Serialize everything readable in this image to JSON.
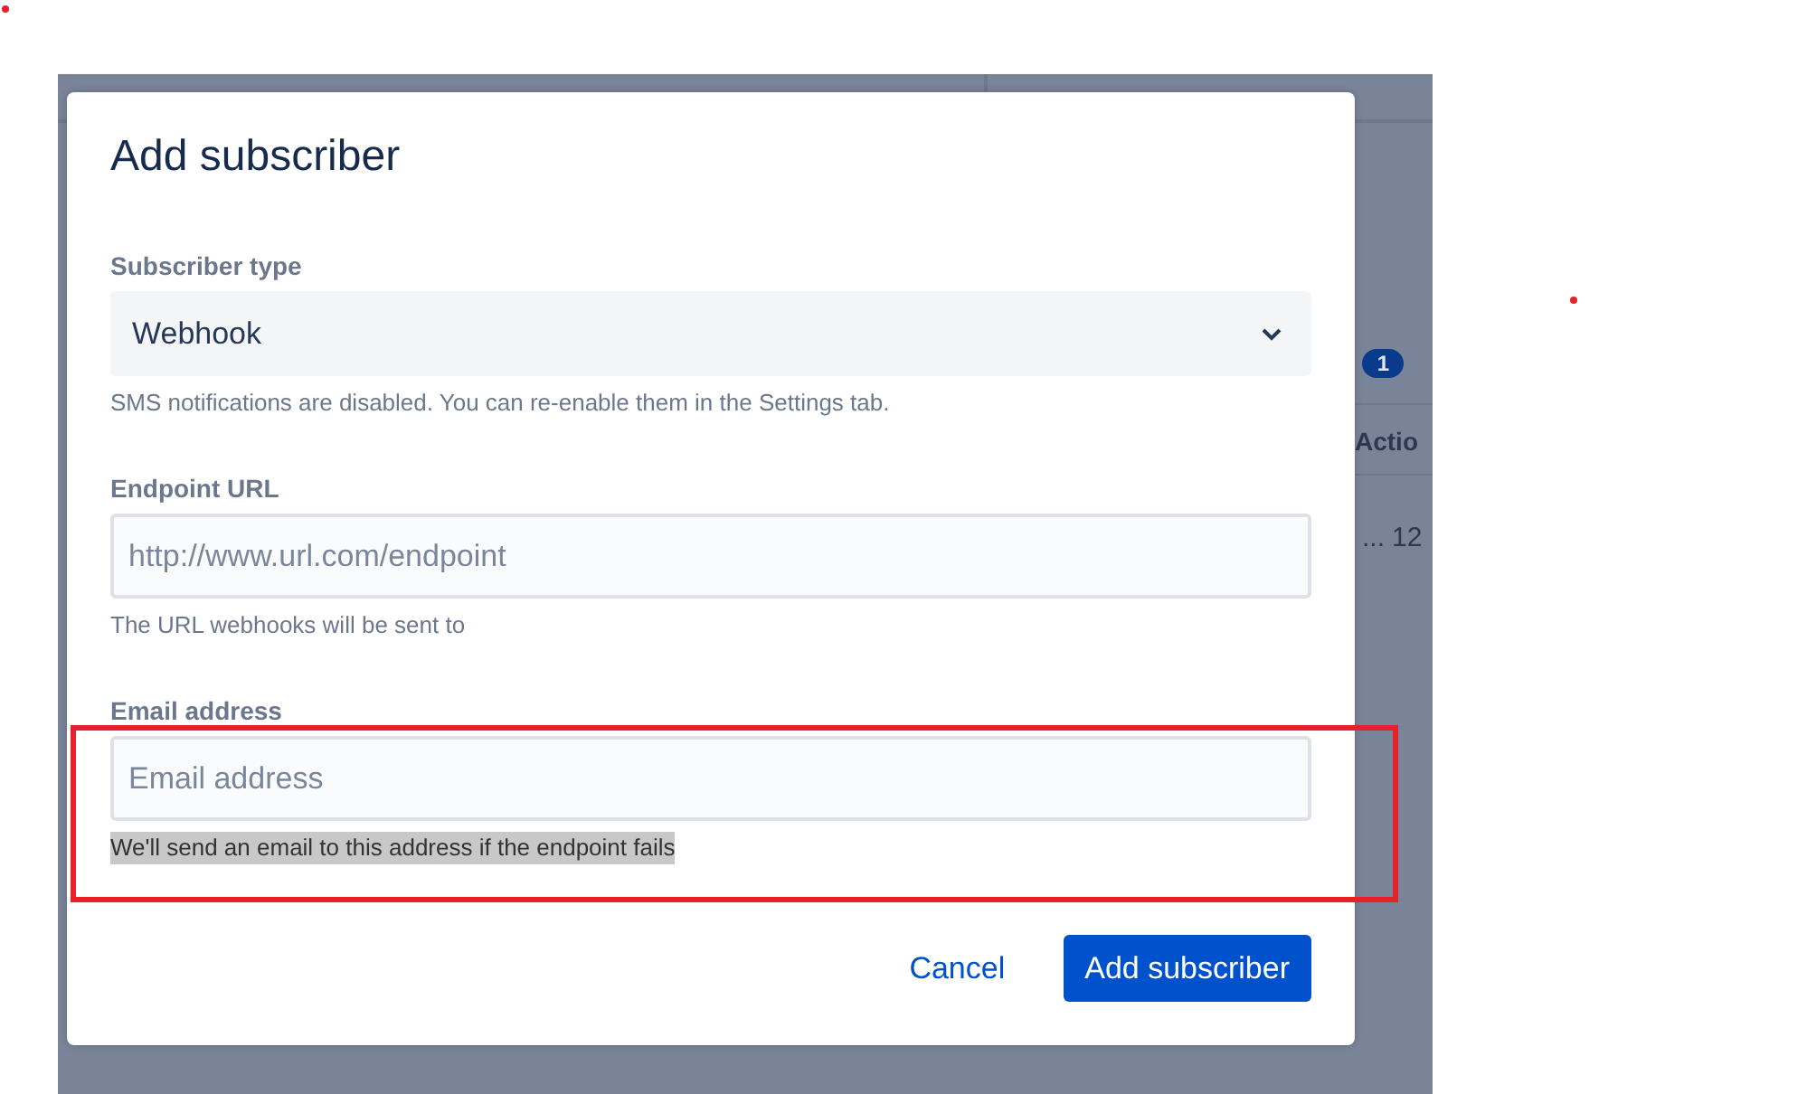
{
  "background_page": {
    "badge": "1",
    "column_header": "Actio",
    "row_cell_1": "...",
    "row_cell_2": "12"
  },
  "modal": {
    "title": "Add subscriber",
    "fields": [
      {
        "kind": "select",
        "label": "Subscriber type",
        "value": "Webhook",
        "helper": "SMS notifications are disabled. You can re-enable them in the Settings tab.",
        "helper_highlighted": false
      },
      {
        "kind": "input",
        "label": "Endpoint URL",
        "placeholder": "http://www.url.com/endpoint",
        "helper": "The URL webhooks will be sent to",
        "helper_highlighted": false
      },
      {
        "kind": "input",
        "label": "Email address",
        "placeholder": "Email address",
        "helper": "We'll send an email to this address if the endpoint fails",
        "helper_highlighted": true
      }
    ],
    "buttons": [
      {
        "kind": "link",
        "label": "Cancel"
      },
      {
        "kind": "primary",
        "label": "Add subscriber"
      }
    ]
  },
  "annotation": {
    "highlight_frame": true,
    "marker_dots": true
  }
}
